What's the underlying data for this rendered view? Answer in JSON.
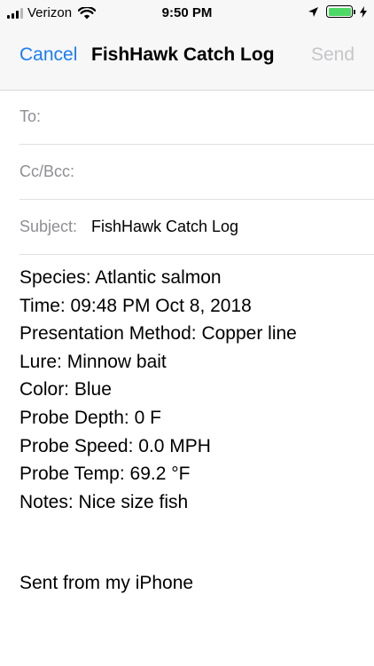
{
  "status_bar": {
    "carrier": "Verizon",
    "time": "9:50 PM",
    "icons": [
      "signal-icon",
      "wifi-icon",
      "location-arrow-icon",
      "battery-icon",
      "charging-bolt-icon"
    ],
    "battery_color": "#4cd964"
  },
  "nav": {
    "cancel_label": "Cancel",
    "title": "FishHawk Catch Log",
    "send_label": "Send",
    "accent_color": "#1b7cf6"
  },
  "fields": {
    "to_label": "To:",
    "cc_label": "Cc/Bcc:",
    "subject_label": "Subject:",
    "subject_value": "FishHawk Catch Log"
  },
  "body": {
    "lines": [
      "Species: Atlantic salmon",
      "Time: 09:48 PM Oct 8, 2018",
      "Presentation Method: Copper line",
      "Lure: Minnow bait",
      "Color: Blue",
      "Probe Depth: 0 F",
      "Probe Speed: 0.0 MPH",
      "Probe Temp: 69.2 °F",
      "Notes: Nice size fish"
    ],
    "signature": "Sent from my iPhone"
  }
}
